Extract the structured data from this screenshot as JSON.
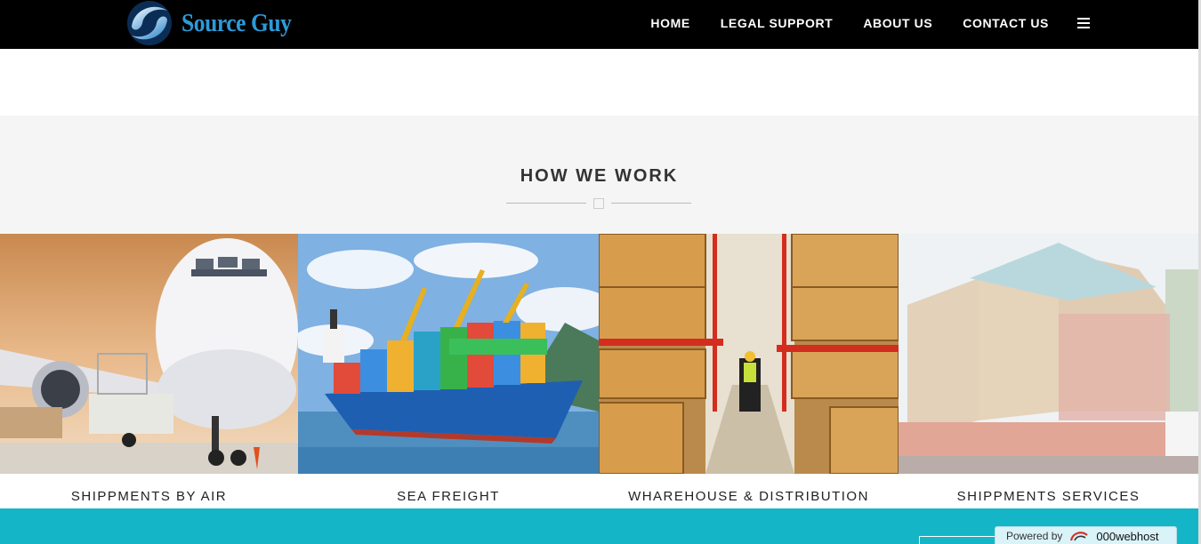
{
  "brand": {
    "name": "Source Guy"
  },
  "nav": {
    "items": [
      "HOME",
      "LEGAL SUPPORT",
      "ABOUT US",
      "CONTACT US"
    ],
    "menu_icon": "hamburger-icon"
  },
  "section": {
    "title": "HOW WE WORK"
  },
  "services": [
    {
      "caption": "SHIPPMENTS BY AIR",
      "image": "airplane-cargo-image"
    },
    {
      "caption": "SEA FREIGHT",
      "image": "container-ship-image"
    },
    {
      "caption": "WHAREHOUSE & DISTRIBUTION",
      "image": "warehouse-image"
    },
    {
      "caption": "SHIPPMENTS SERVICES",
      "image": "crated-cargo-image"
    }
  ],
  "footer": {
    "powered_label": "Powered by",
    "powered_brand": "000webhost"
  },
  "colors": {
    "header_bg": "#000000",
    "logo_blue": "#2d9ad8",
    "footer_teal": "#15b5c8",
    "section_bg": "#f5f5f5"
  }
}
